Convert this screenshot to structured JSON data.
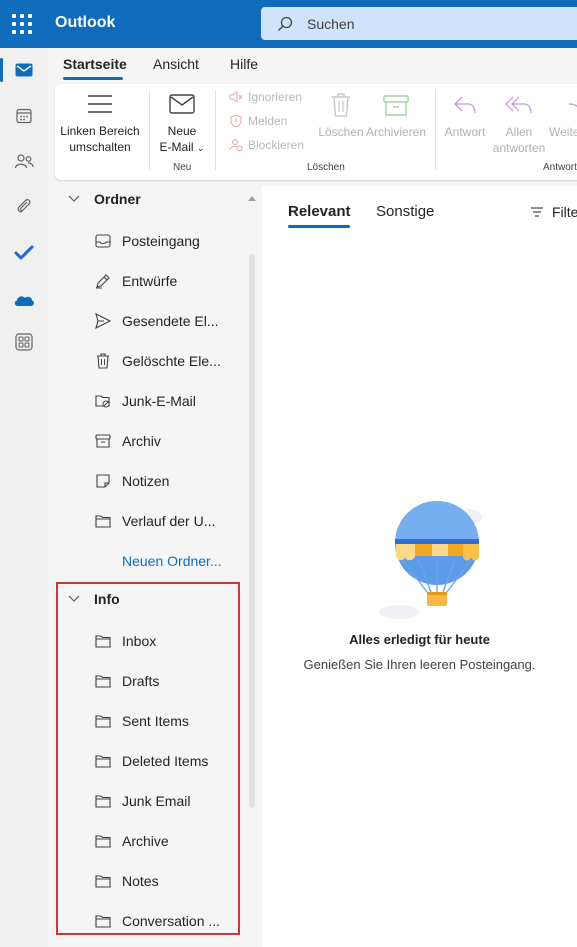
{
  "app": {
    "title": "Outlook"
  },
  "search": {
    "placeholder": "Suchen"
  },
  "rail": {
    "items": [
      "mail",
      "calendar",
      "people",
      "attachments",
      "todo",
      "onedrive",
      "apps"
    ]
  },
  "tabs": [
    {
      "label": "Startseite",
      "active": true
    },
    {
      "label": "Ansicht"
    },
    {
      "label": "Hilfe"
    }
  ],
  "ribbon": {
    "toggle_pane": "Linken Bereich umschalten",
    "new_mail_line1": "Neue",
    "new_mail_line2": "E-Mail",
    "group_new": "Neu",
    "ignore": "Ignorieren",
    "report": "Melden",
    "block": "Blockieren",
    "delete": "Löschen",
    "archive": "Archivieren",
    "group_delete": "Löschen",
    "reply": "Antwort",
    "reply_all_line1": "Allen",
    "reply_all_line2": "antworten",
    "forward": "Weite",
    "group_respond": "Antwort"
  },
  "folders": {
    "section1": "Ordner",
    "items1": [
      {
        "label": "Posteingang",
        "icon": "inbox-icon"
      },
      {
        "label": "Entwürfe",
        "icon": "pencil-icon"
      },
      {
        "label": "Gesendete El...",
        "icon": "send-icon"
      },
      {
        "label": "Gelöschte Ele...",
        "icon": "trash-icon"
      },
      {
        "label": "Junk-E-Mail",
        "icon": "junk-icon"
      },
      {
        "label": "Archiv",
        "icon": "archive-icon"
      },
      {
        "label": "Notizen",
        "icon": "note-icon"
      },
      {
        "label": "Verlauf der U...",
        "icon": "folder-icon"
      }
    ],
    "new_folder": "Neuen Ordner...",
    "section2": "Info",
    "items2": [
      {
        "label": "Inbox"
      },
      {
        "label": "Drafts"
      },
      {
        "label": "Sent Items"
      },
      {
        "label": "Deleted Items"
      },
      {
        "label": "Junk Email"
      },
      {
        "label": "Archive"
      },
      {
        "label": "Notes"
      },
      {
        "label": "Conversation ..."
      }
    ]
  },
  "mail": {
    "tab_focused": "Relevant",
    "tab_other": "Sonstige",
    "filter": "Filte",
    "empty_title": "Alles erledigt für heute",
    "empty_sub": "Genießen Sie Ihren leeren Posteingang."
  },
  "colors": {
    "brand": "#0f6cbd",
    "highlight": "#d13438"
  }
}
